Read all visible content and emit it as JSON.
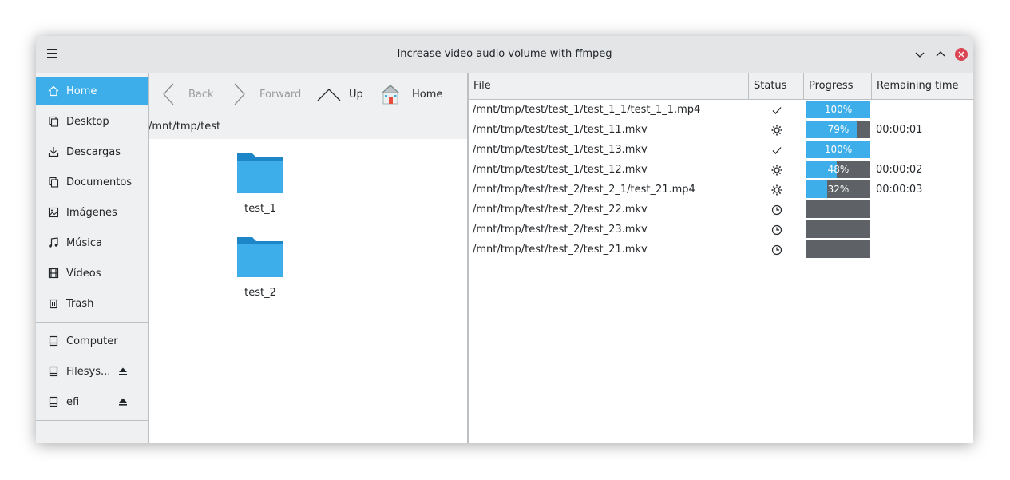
{
  "window": {
    "title": "Increase video audio volume with ffmpeg"
  },
  "sidebar": {
    "places": [
      {
        "label": "Home",
        "icon": "home-icon"
      },
      {
        "label": "Desktop",
        "icon": "folder-icon"
      },
      {
        "label": "Descargas",
        "icon": "download-icon"
      },
      {
        "label": "Documentos",
        "icon": "folder-icon"
      },
      {
        "label": "Imágenes",
        "icon": "image-icon"
      },
      {
        "label": "Música",
        "icon": "music-icon"
      },
      {
        "label": "Vídeos",
        "icon": "film-icon"
      },
      {
        "label": "Trash",
        "icon": "trash-icon"
      }
    ],
    "devices": [
      {
        "label": "Computer",
        "icon": "drive-icon"
      },
      {
        "label": "Filesys...",
        "icon": "drive-icon"
      },
      {
        "label": "efi",
        "icon": "drive-icon"
      }
    ]
  },
  "nav": {
    "back": "Back",
    "forward": "Forward",
    "up": "Up",
    "home": "Home"
  },
  "browser": {
    "path": "/mnt/tmp/test",
    "folders": [
      "test_1",
      "test_2"
    ]
  },
  "table": {
    "headers": {
      "file": "File",
      "status": "Status",
      "progress": "Progress",
      "remaining": "Remaining time"
    },
    "rows": [
      {
        "file": "/mnt/tmp/test/test_1/test_1_1/test_1_1.mp4",
        "status": "done",
        "progress": 100,
        "progress_text": "100%",
        "remaining": ""
      },
      {
        "file": "/mnt/tmp/test/test_1/test_11.mkv",
        "status": "processing",
        "progress": 79,
        "progress_text": "79%",
        "remaining": "00:00:01"
      },
      {
        "file": "/mnt/tmp/test/test_1/test_13.mkv",
        "status": "done",
        "progress": 100,
        "progress_text": "100%",
        "remaining": ""
      },
      {
        "file": "/mnt/tmp/test/test_1/test_12.mkv",
        "status": "processing",
        "progress": 48,
        "progress_text": "48%",
        "remaining": "00:00:02"
      },
      {
        "file": "/mnt/tmp/test/test_2/test_2_1/test_21.mp4",
        "status": "processing",
        "progress": 32,
        "progress_text": "32%",
        "remaining": "00:00:03"
      },
      {
        "file": "/mnt/tmp/test/test_2/test_22.mkv",
        "status": "pending",
        "progress": 0,
        "progress_text": "",
        "remaining": ""
      },
      {
        "file": "/mnt/tmp/test/test_2/test_23.mkv",
        "status": "pending",
        "progress": 0,
        "progress_text": "",
        "remaining": ""
      },
      {
        "file": "/mnt/tmp/test/test_2/test_21.mkv",
        "status": "pending",
        "progress": 0,
        "progress_text": "",
        "remaining": ""
      }
    ]
  },
  "colors": {
    "accent": "#3daee9",
    "progress_track": "#5e6165",
    "close_button": "#da4453"
  }
}
